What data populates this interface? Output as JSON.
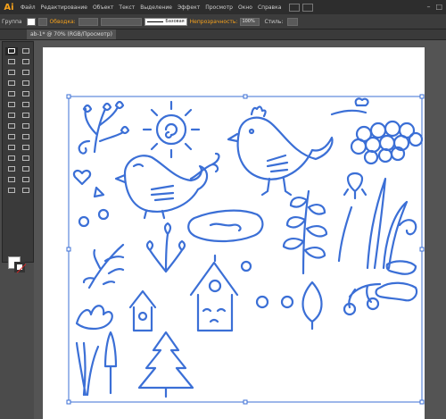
{
  "app": {
    "logo": "Ai"
  },
  "menu": [
    {
      "label": "Файл"
    },
    {
      "label": "Редактирование"
    },
    {
      "label": "Объект"
    },
    {
      "label": "Текст"
    },
    {
      "label": "Выделение"
    },
    {
      "label": "Эффект"
    },
    {
      "label": "Просмотр"
    },
    {
      "label": "Окно"
    },
    {
      "label": "Справка"
    }
  ],
  "control_bar": {
    "selection_label": "Группа",
    "stroke_label": "Обводка:",
    "stroke_profile": "Базовая",
    "opacity_label": "Непрозрачность:",
    "opacity_value": "100%",
    "style_label": "Стиль:"
  },
  "document_tab": {
    "title": "ab-1* @ 70% (RGB/Просмотр)"
  },
  "colors": {
    "accent": "#f7a21b",
    "selection": "#3b6fd6",
    "fill": "#ffffff",
    "stroke_none": "#dd2222"
  },
  "icons": [
    "ai-logo-icon",
    "bridge-icon",
    "arrange-icon",
    "selection-tool-icon",
    "direct-selection-icon",
    "fill-swatch-icon",
    "stroke-swatch-icon"
  ]
}
